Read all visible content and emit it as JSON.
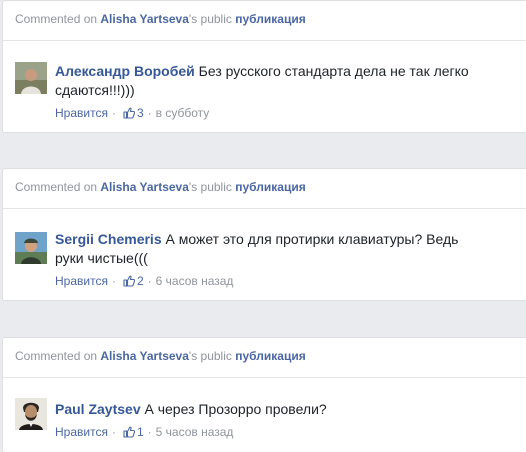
{
  "header_parts": {
    "prefix": "Commented on",
    "owner": "Alisha Yartseva",
    "possessive": "'s public",
    "object": "публикация"
  },
  "items": [
    {
      "author": "Александр Воробей",
      "text": "Без русского стандарта дела не так легко сдаются!!!)))",
      "like_label": "Нравится",
      "likes": "3",
      "time": "в субботу",
      "avatar": "avatar-photo-man-outdoors"
    },
    {
      "author": "Sergii Chemeris",
      "text": "А может это для протирки клавиатуры? Ведь руки чистые(((",
      "like_label": "Нравится",
      "likes": "2",
      "time": "6 часов назад",
      "avatar": "avatar-photo-man-cap"
    },
    {
      "author": "Paul Zaytsev",
      "text": "А через Прозорро провели?",
      "like_label": "Нравится",
      "likes": "1",
      "time": "5 часов назад",
      "avatar": "avatar-photo-lincoln-portrait"
    }
  ],
  "colors": {
    "link": "#365899",
    "meta": "#90949c",
    "background": "#e9ebee"
  }
}
